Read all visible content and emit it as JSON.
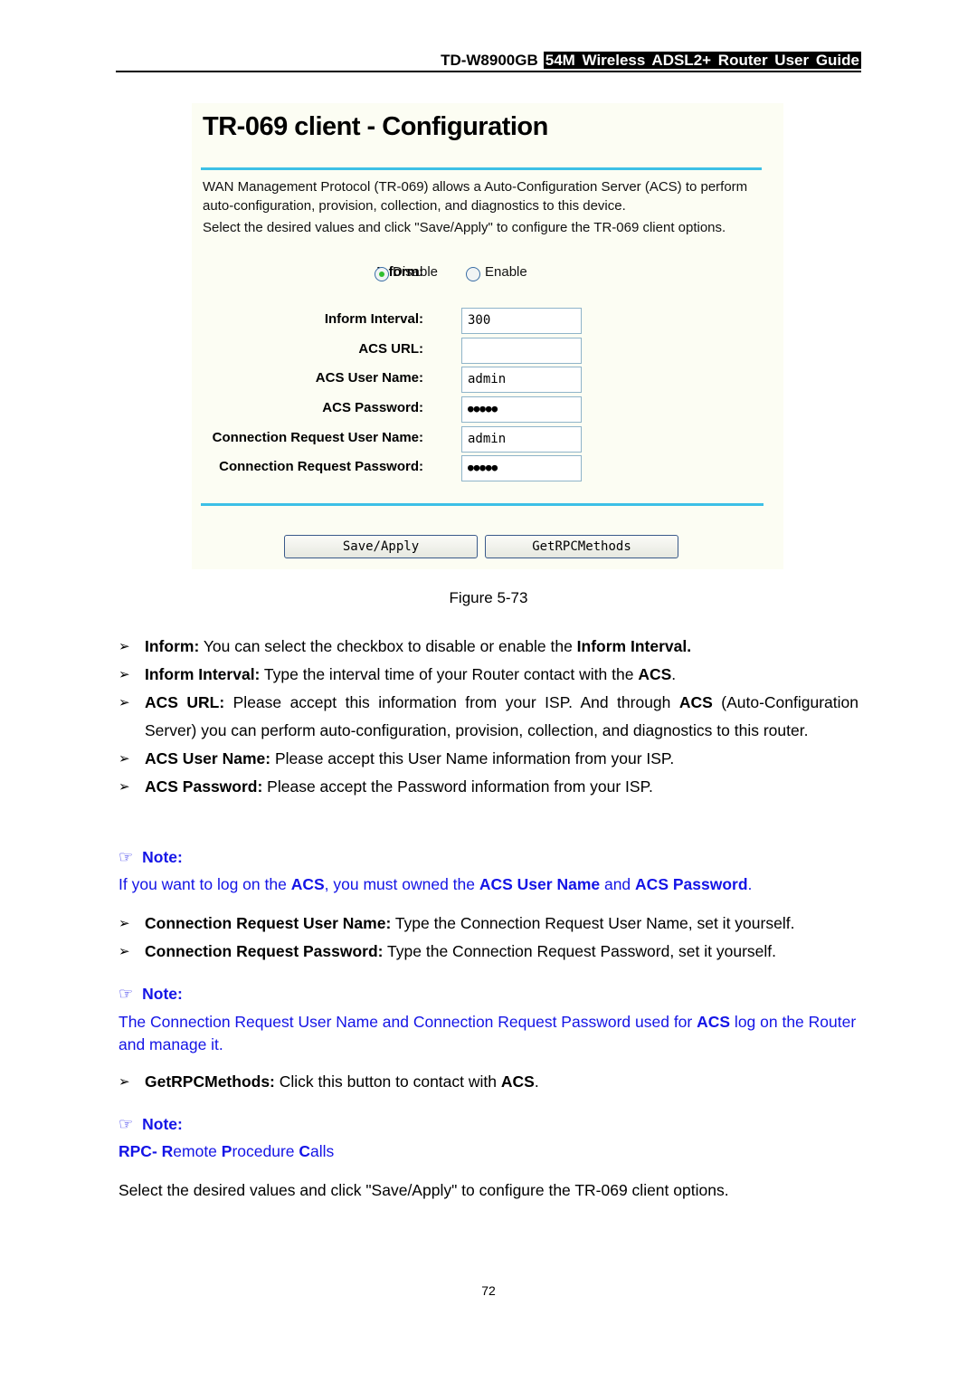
{
  "header": {
    "model": "TD-W8900GB",
    "guide": "54M Wireless ADSL2+ Router User Guide"
  },
  "screenshot": {
    "title": "TR-069 client - Configuration",
    "desc1": "WAN Management Protocol (TR-069) allows a Auto-Configuration Server (ACS) to perform auto-configuration, provision, collection, and diagnostics to this device.",
    "desc2": "Select the desired values and click \"Save/Apply\" to configure the TR-069 client options.",
    "inform_label": "Inform:",
    "inform_options": [
      {
        "label": "Disable",
        "checked": true
      },
      {
        "label": "Enable",
        "checked": false
      }
    ],
    "fields": [
      {
        "label": "Inform Interval:",
        "value": "300"
      },
      {
        "label": "ACS URL:",
        "value": ""
      },
      {
        "label": "ACS User Name:",
        "value": "admin"
      },
      {
        "label": "ACS Password:",
        "value": "●●●●●"
      },
      {
        "label": "Connection Request User Name:",
        "value": "admin"
      },
      {
        "label": "Connection Request Password:",
        "value": "●●●●●"
      }
    ],
    "buttons": {
      "save": "Save/Apply",
      "getrpc": "GetRPCMethods"
    }
  },
  "caption": "Figure 5-73",
  "bullets1": [
    {
      "term": "Inform:",
      "text": " You can select the checkbox to disable or enable the ",
      "bold_tail": "Inform Interval."
    },
    {
      "term": "Inform Interval:",
      "text": " Type the interval time of your Router contact with the ",
      "bold_tail": "ACS",
      "tail": "."
    },
    {
      "term": "ACS URL:",
      "text_a": " Please accept this information from your ISP. And through ",
      "bold_mid": "ACS",
      "text_b": " (Auto-Configuration Server) you can perform auto-configuration, provision, collection, and diagnostics to this router."
    },
    {
      "term": "ACS User Name:",
      "text": " Please accept this User Name information from your ISP."
    },
    {
      "term": "ACS Password:",
      "text": " Please accept the Password information from your ISP."
    }
  ],
  "note_label": "Note:",
  "note1": {
    "p1": "If you want to log on the ",
    "b1": "ACS",
    "p2": ", you must owned the ",
    "b2": "ACS User Name",
    "p3": " and ",
    "b3": "ACS Password",
    "p4": "."
  },
  "bullets2": [
    {
      "term": "Connection Request User Name:",
      "text": " Type the Connection Request User Name, set it yourself."
    },
    {
      "term": "Connection Request Password:",
      "text": " Type the Connection Request Password, set it yourself."
    }
  ],
  "note2": {
    "p1": "The Connection Request User Name and Connection Request Password used for ",
    "b1": "ACS",
    "p2": " log on the Router and manage it."
  },
  "bullet3": {
    "term": "GetRPCMethods:",
    "text": " Click this button to contact with ",
    "bold_tail": "ACS",
    "tail": "."
  },
  "note3": {
    "b1": "RPC- R",
    "p1": "emote ",
    "b2": "P",
    "p2": "rocedure ",
    "b3": "C",
    "p3": "alls"
  },
  "closing": "Select the desired values and click \"Save/Apply\" to configure the TR-069 client options.",
  "page_number": "72"
}
